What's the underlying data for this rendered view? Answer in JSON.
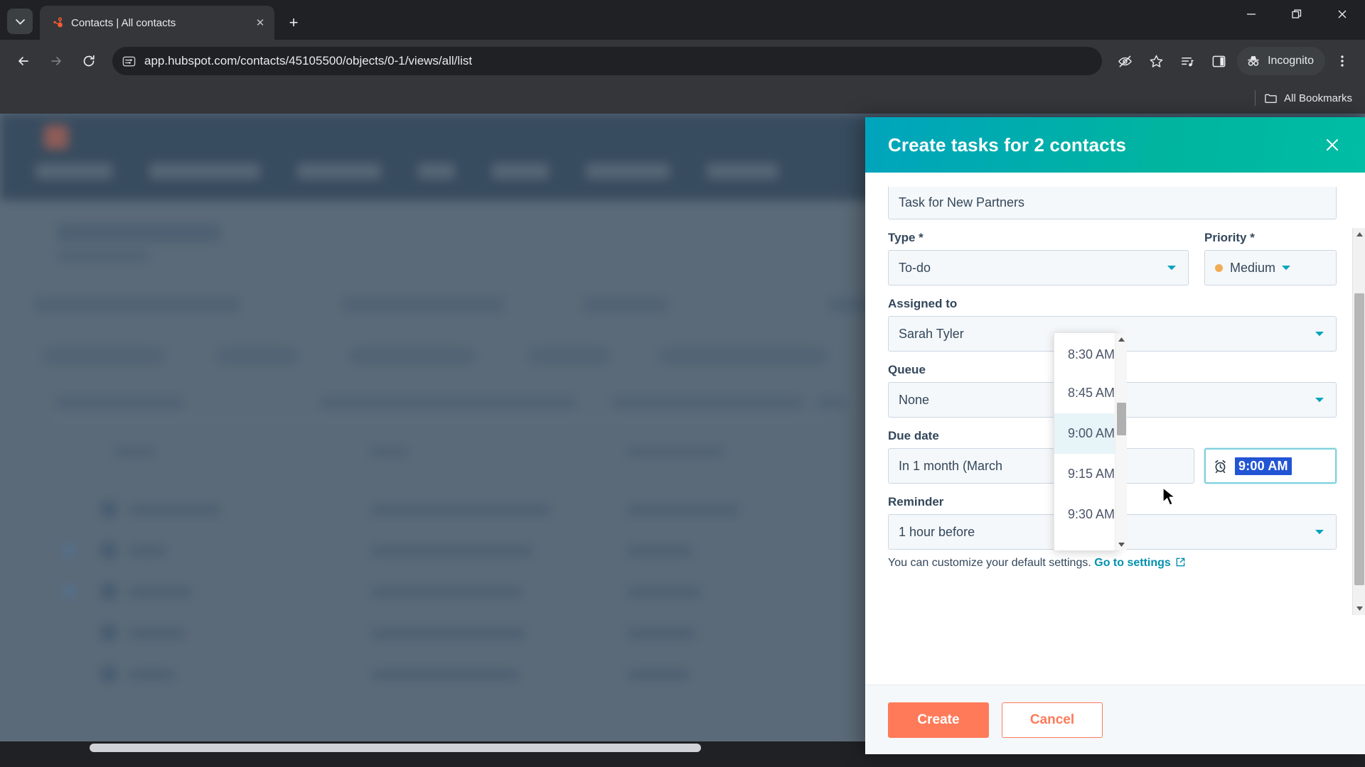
{
  "browser": {
    "tab": {
      "title": "Contacts | All contacts",
      "favicon_name": "hubspot-favicon",
      "close_label": "✕"
    },
    "new_tab_label": "+",
    "tab_list_label": "▼",
    "window_controls": {
      "minimize": "—",
      "restore": "❐",
      "close": "✕"
    },
    "nav": {
      "back": "←",
      "forward": "→",
      "reload": "⟳"
    },
    "omnibox": {
      "url": "app.hubspot.com/contacts/45105500/objects/0-1/views/all/list",
      "site_info_icon": "site-settings-icon"
    },
    "toolbar_icons": [
      {
        "name": "hide-password-icon",
        "glyph": "👁"
      },
      {
        "name": "bookmark-star-icon",
        "glyph": "☆"
      },
      {
        "name": "reading-list-icon",
        "glyph": "≣"
      },
      {
        "name": "side-panel-icon",
        "glyph": "◭"
      },
      {
        "name": "chrome-menu-icon",
        "glyph": "⋮"
      }
    ],
    "incognito": {
      "label": "Incognito",
      "icon_name": "incognito-hat-icon"
    },
    "bookmarks_bar": {
      "all_bookmarks_label": "All Bookmarks",
      "folder_icon": "folder-icon"
    }
  },
  "modal": {
    "title": "Create tasks for 2 contacts",
    "close_label": "✕",
    "header_color": "#00b0a8",
    "fields": {
      "task_title": {
        "value": "Task for New Partners"
      },
      "type": {
        "label": "Type *",
        "value": "To-do"
      },
      "priority": {
        "label": "Priority *",
        "value": "Medium",
        "dot_color": "#f2ac53"
      },
      "assigned_to": {
        "label": "Assigned to",
        "value": "Sarah Tyler"
      },
      "queue": {
        "label": "Queue",
        "value": "None"
      },
      "due_date": {
        "label": "Due date",
        "value": "In 1 month (March"
      },
      "due_time": {
        "value": "9:00 AM",
        "icon_name": "alarm-clock-icon"
      },
      "reminder": {
        "label": "Reminder",
        "value": "1 hour before"
      }
    },
    "helper": {
      "text": "You can customize your default settings. ",
      "link": "Go to settings",
      "link_icon": "external-link-icon"
    },
    "footer": {
      "create_label": "Create",
      "cancel_label": "Cancel",
      "create_color": "#ff7a59"
    }
  },
  "time_dropdown": {
    "options": [
      "8:30 AM",
      "8:45 AM",
      "9:00 AM",
      "9:15 AM",
      "9:30 AM"
    ],
    "selected": "9:00 AM",
    "scroll_up_label": "▲",
    "scroll_down_label": "▼"
  },
  "page_background": {
    "app": "HubSpot Contacts",
    "nav_color": "#33475b",
    "overlay_color": "#5b6a78"
  }
}
